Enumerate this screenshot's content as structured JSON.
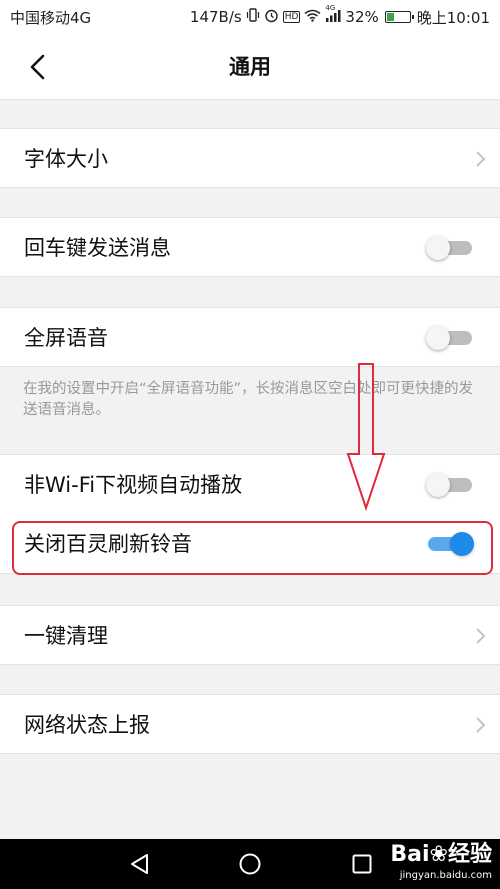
{
  "status_bar": {
    "carrier": "中国移动4G",
    "speed": "147B/s",
    "network_small": "4G",
    "battery_percent": "32%",
    "battery_level": 0.32,
    "time": "晚上10:01",
    "icons": [
      "vibrate-icon",
      "alarm-icon",
      "hd-icon",
      "wifi-icon",
      "signal-icon",
      "battery-icon"
    ]
  },
  "header": {
    "title": "通用",
    "back_icon": "chevron-left-icon"
  },
  "settings": {
    "font_size": {
      "label": "字体大小",
      "type": "link"
    },
    "enter_send": {
      "label": "回车键发送消息",
      "type": "toggle",
      "on": false
    },
    "fullscreen_voice": {
      "label": "全屏语音",
      "type": "toggle",
      "on": false
    },
    "fullscreen_voice_note": "在我的设置中开启“全屏语音功能”，长按消息区空白处即可更快捷的发送语音消息。",
    "autoplay_video": {
      "label": "非Wi-Fi下视频自动播放",
      "type": "toggle",
      "on": false
    },
    "close_ringtone": {
      "label": "关闭百灵刷新铃音",
      "type": "toggle",
      "on": true
    },
    "one_click_clean": {
      "label": "一键清理",
      "type": "link"
    },
    "network_report": {
      "label": "网络状态上报",
      "type": "link"
    }
  },
  "annotation": {
    "color": "#e02b3b"
  },
  "nav_bar": {
    "buttons": [
      "back-triangle-icon",
      "home-circle-icon",
      "recents-square-icon"
    ]
  },
  "watermark": {
    "brand_prefix": "Bai",
    "brand_suffix": "经验",
    "url": "jingyan.baidu.com"
  },
  "colors": {
    "accent": "#1c8ae6",
    "toggle_off": "#bdbdbd",
    "background": "#f2f2f2"
  }
}
